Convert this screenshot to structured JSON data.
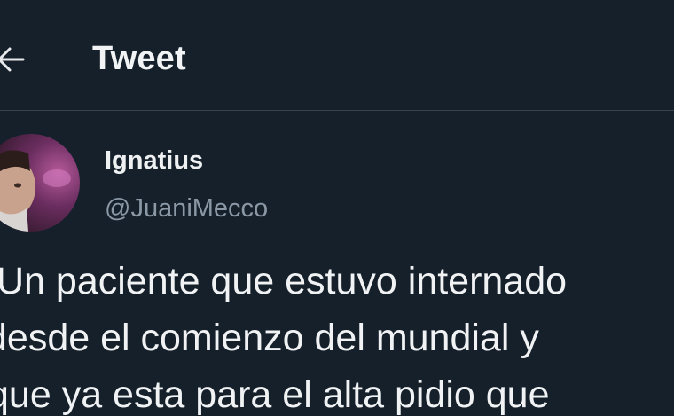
{
  "header": {
    "back_icon": "arrow-left-icon",
    "title": "Tweet"
  },
  "tweet": {
    "author": {
      "display_name": "Ignatius",
      "handle": "@JuaniMecco",
      "avatar_icon": "user-avatar"
    },
    "lines": [
      "Un paciente que estuvo internado",
      "desde el comienzo del mundial y",
      "que ya esta para el alta pidio que"
    ]
  },
  "colors": {
    "background": "#15202b",
    "text_primary": "#e7e9ea",
    "text_secondary": "#8b98a5",
    "divider": "#38444d"
  }
}
